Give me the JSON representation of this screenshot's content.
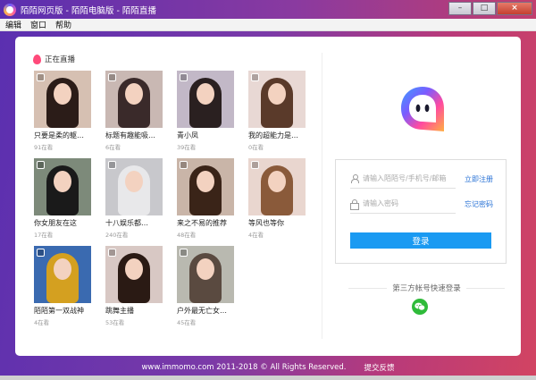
{
  "window": {
    "title": "陌陌网页版 - 陌陌电脑版 - 陌陌直播",
    "min_label": "–",
    "max_label": "□",
    "close_label": "×"
  },
  "menu": [
    {
      "label": "编辑"
    },
    {
      "label": "窗口"
    },
    {
      "label": "帮助"
    }
  ],
  "live": {
    "section_title": "正在直播",
    "tiles": [
      {
        "title": "只要是柔的躯…",
        "count": "91在看",
        "bg": "#d6c0b2",
        "hair": "#2b1c18"
      },
      {
        "title": "标题有趣能吸…",
        "count": "6在看",
        "bg": "#c9b8b3",
        "hair": "#3a2a2a"
      },
      {
        "title": "青小凤",
        "count": "39在看",
        "bg": "#c2b8c7",
        "hair": "#2a2020"
      },
      {
        "title": "我的超能力是…",
        "count": "0在看",
        "bg": "#e8d8d4",
        "hair": "#5a3a2a"
      },
      {
        "title": "你女朋友在这",
        "count": "17在看",
        "bg": "#7d8a7a",
        "hair": "#1a1a1a"
      },
      {
        "title": "十八娱乐都…",
        "count": "240在看",
        "bg": "#c8c8cc",
        "hair": "#e8e8ea"
      },
      {
        "title": "来之不易的推荐",
        "count": "48在看",
        "bg": "#c9b5a8",
        "hair": "#3a2418"
      },
      {
        "title": "等风也等你",
        "count": "4在看",
        "bg": "#e9d6cf",
        "hair": "#8a5a3a"
      },
      {
        "title": "陌陌第一双战神",
        "count": "4在看",
        "bg": "#3a6ab0",
        "hair": "#d4a020"
      },
      {
        "title": "跳舞主播",
        "count": "53在看",
        "bg": "#d8c8c4",
        "hair": "#2a1a14"
      },
      {
        "title": "户外最无亡女…",
        "count": "45在看",
        "bg": "#b9b9b0",
        "hair": "#5a4a40"
      }
    ]
  },
  "login": {
    "account_placeholder": "请输入陌陌号/手机号/邮箱",
    "password_placeholder": "请输入密码",
    "register_label": "立即注册",
    "forgot_label": "忘记密码",
    "login_label": "登录",
    "third_party_label": "第三方帐号快速登录"
  },
  "footer": {
    "copyright": "www.immomo.com 2011-2018 © All Rights Reserved.",
    "feedback": "提交反馈"
  },
  "colors": {
    "accent_blue": "#1a9af2",
    "link_blue": "#2a73d6",
    "live_flame": "#ff4a7a",
    "wechat_green": "#2fbb3a"
  }
}
